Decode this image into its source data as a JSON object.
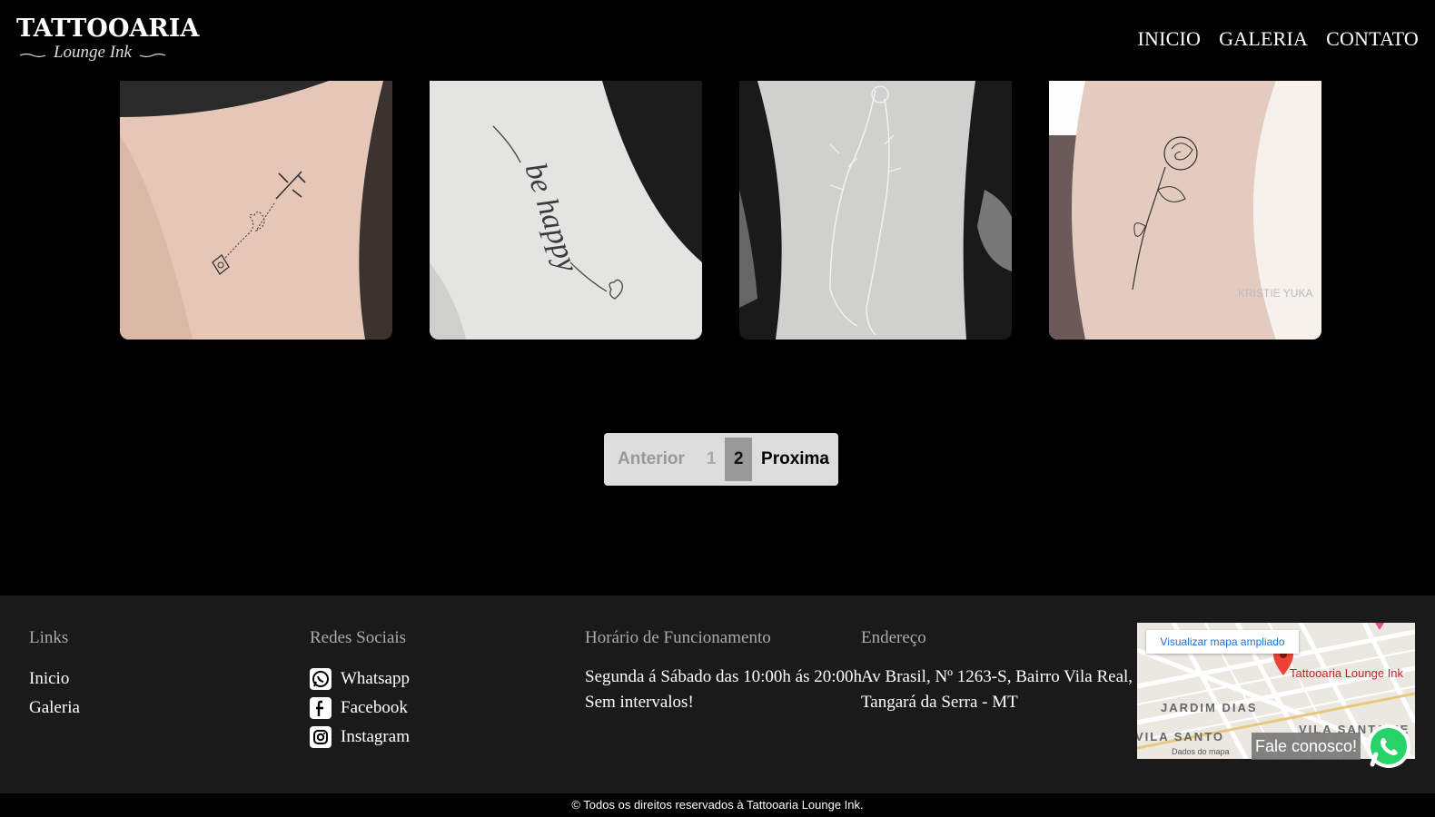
{
  "header": {
    "logo_main": "TATTOOARIA",
    "logo_sub": "Lounge Ink",
    "nav": [
      "INICIO",
      "GALERIA",
      "CONTATO"
    ]
  },
  "gallery": {
    "photos": [
      {
        "icon": "tattoo-airplane-heart-photo",
        "watermark": ""
      },
      {
        "icon": "tattoo-be-happy-photo",
        "text": "be happy",
        "watermark": ""
      },
      {
        "icon": "tattoo-hands-floral-photo",
        "watermark": ""
      },
      {
        "icon": "tattoo-rose-photo",
        "watermark": "KRISTIE YUKA"
      }
    ]
  },
  "pagination": {
    "prev": "Anterior",
    "pages": [
      "1",
      "2"
    ],
    "current": "2",
    "next": "Proxima"
  },
  "footer": {
    "links": {
      "title": "Links",
      "items": [
        "Inicio",
        "Galeria"
      ]
    },
    "social": {
      "title": "Redes Sociais",
      "items": [
        {
          "label": "Whatsapp",
          "icon": "whatsapp-icon"
        },
        {
          "label": "Facebook",
          "icon": "facebook-icon"
        },
        {
          "label": "Instagram",
          "icon": "instagram-icon"
        }
      ]
    },
    "hours": {
      "title": "Horário de Funcionamento",
      "line1": "Segunda á Sábado das 10:00h ás 20:00h",
      "line2": "Sem intervalos!"
    },
    "address": {
      "title": "Endereço",
      "line1": "Av Brasil, Nº 1263-S, Bairro Vila Real,",
      "line2": "Tangará da Serra - MT"
    },
    "map": {
      "button": "Visualizar mapa ampliado",
      "place": "Tattooaria Lounge Ink",
      "area1": "JARDIM DIAS",
      "area2": "VILA SANTO",
      "area3": "VILA SANTA FE",
      "footer": "Dados do mapa"
    }
  },
  "float_chat": {
    "label": "Fale conosco!",
    "icon": "whatsapp-icon"
  },
  "copyright": "© Todos os direitos reservados à Tattooaria Lounge Ink.",
  "colors": {
    "background": "#000000",
    "footer": "#1a1a1a",
    "pager": "#dddddd",
    "pager_active": "#999999",
    "whatsapp": "#25d366"
  }
}
